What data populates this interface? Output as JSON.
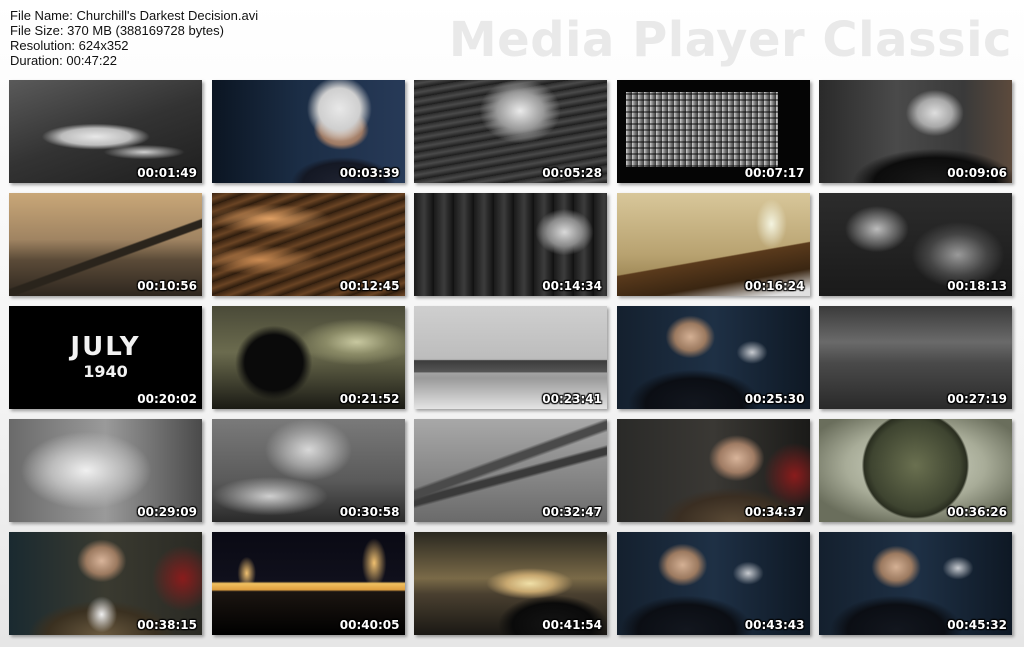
{
  "file_info": {
    "file_name": "File Name: Churchill's Darkest Decision.avi",
    "file_size": "File Size: 370 MB (388169728 bytes)",
    "resolution": "Resolution: 624x352",
    "duration": "Duration: 00:47:22"
  },
  "brand": "Media Player Classic",
  "thumbnails": [
    {
      "time": "00:01:49"
    },
    {
      "time": "00:03:39"
    },
    {
      "time": "00:05:28"
    },
    {
      "time": "00:07:17"
    },
    {
      "time": "00:09:06"
    },
    {
      "time": "00:10:56"
    },
    {
      "time": "00:12:45"
    },
    {
      "time": "00:14:34"
    },
    {
      "time": "00:16:24"
    },
    {
      "time": "00:18:13"
    },
    {
      "time": "00:20:02",
      "caption_line1": "JULY",
      "caption_line2": "1940"
    },
    {
      "time": "00:21:52"
    },
    {
      "time": "00:23:41"
    },
    {
      "time": "00:25:30"
    },
    {
      "time": "00:27:19"
    },
    {
      "time": "00:29:09"
    },
    {
      "time": "00:30:58"
    },
    {
      "time": "00:32:47"
    },
    {
      "time": "00:34:37"
    },
    {
      "time": "00:36:26"
    },
    {
      "time": "00:38:15"
    },
    {
      "time": "00:40:05"
    },
    {
      "time": "00:41:54"
    },
    {
      "time": "00:43:43"
    },
    {
      "time": "00:45:32"
    }
  ]
}
